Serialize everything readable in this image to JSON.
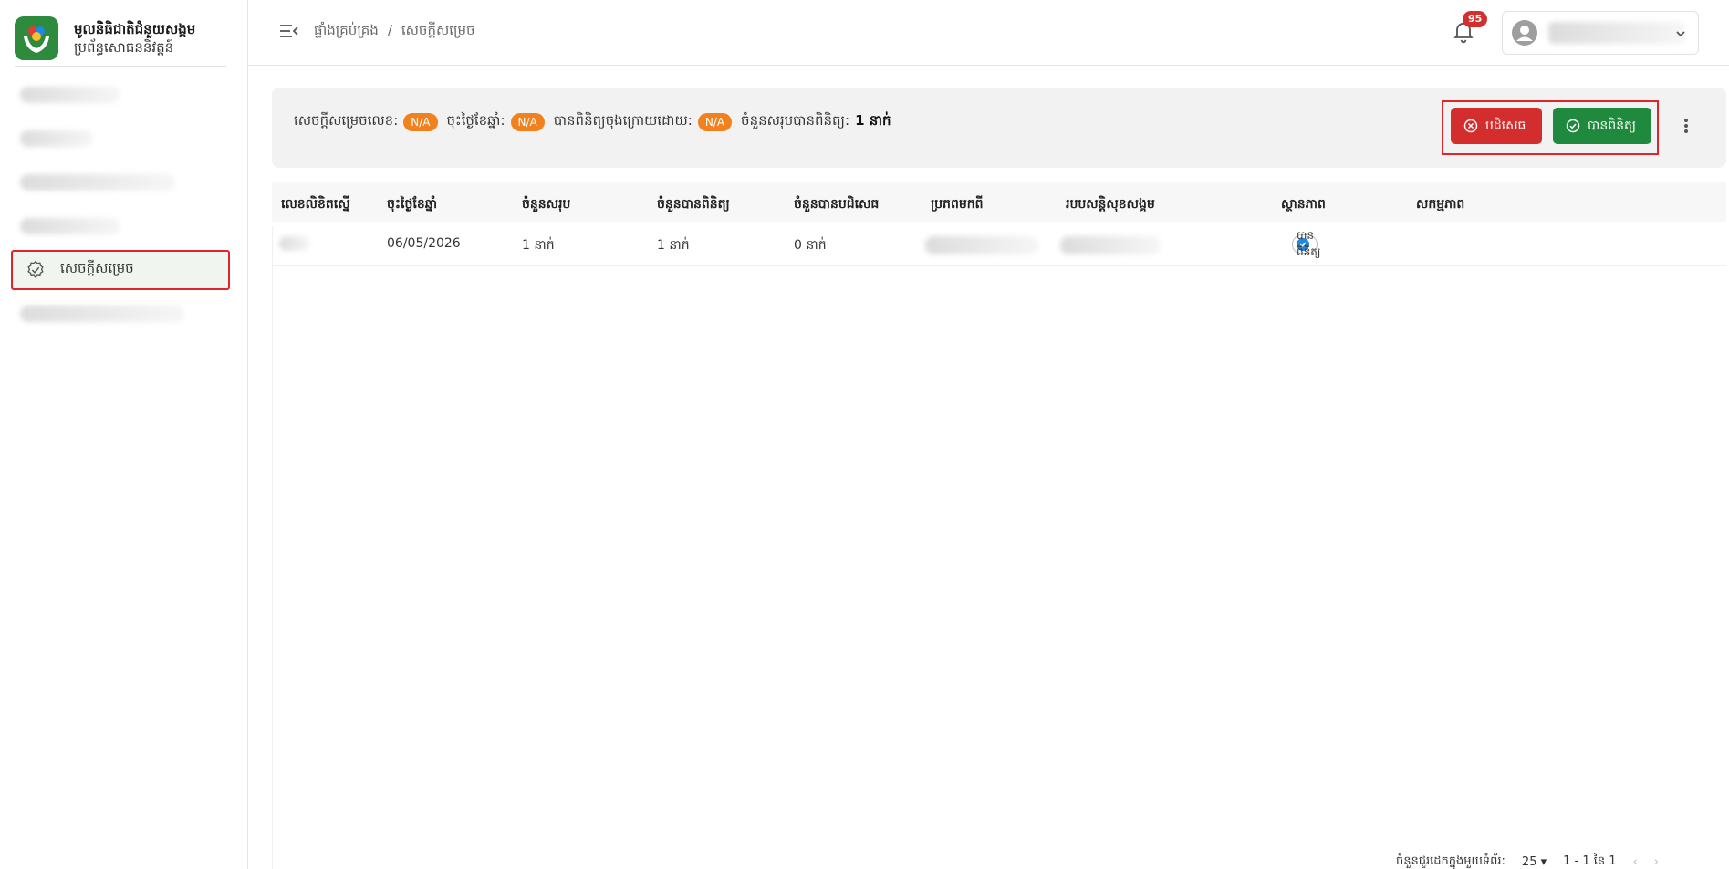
{
  "brand": {
    "title": "មូលនិធិជាតិជំនួយសង្គម",
    "subtitle": "ប្រព័ន្ធសោធននិវត្តន៍"
  },
  "sidebar": {
    "active_item": {
      "label": "សេចក្ដីសម្រេច",
      "icon": "verified-badge-icon"
    }
  },
  "header": {
    "breadcrumb": [
      "ផ្ទាំងគ្រប់គ្រង",
      "/",
      "សេចក្ដីសម្រេច"
    ],
    "notification_count": "95"
  },
  "summary": {
    "decision_no_label": "សេចក្ដីសម្រេចលេខ:",
    "decision_no_value": "N/A",
    "date_label": "ចុះថ្ងៃខែឆ្នាំ:",
    "date_value": "N/A",
    "verified_by_label": "បានពិនិត្យចុងក្រោយដោយ:",
    "verified_by_value": "N/A",
    "total_verified_label": "ចំនួនសរុបបានពិនិត្យ:",
    "total_verified_value": "1 នាក់",
    "reject_button": "បដិសេធ",
    "approve_button": "បានពិនិត្យ"
  },
  "table": {
    "headers": [
      "លេខលិខិតស្នើ",
      "ចុះថ្ងៃខែឆ្នាំ",
      "ចំនួនសរុប",
      "ចំនួនបានពិនិត្យ",
      "ចំនួនបានបដិសេធ",
      "ប្រភពមកពី",
      "របបសន្តិសុខសង្គម",
      "ស្ថានភាព",
      "សកម្មភាព"
    ],
    "rows": [
      {
        "date": "06/05/2026",
        "total": "1 នាក់",
        "verified": "1 នាក់",
        "rejected": "0 នាក់",
        "status": "បានពិនិត្យ"
      }
    ]
  },
  "pagination": {
    "rows_per_page_label": "ចំនួនជួរដេកក្នុងមួយទំព័រ:",
    "rows_per_page": "25",
    "range": "1 - 1 នៃ 1"
  },
  "colors": {
    "primary_green": "#1f8a3e",
    "danger_red": "#d42d2d",
    "pill_orange": "#f0811e"
  }
}
